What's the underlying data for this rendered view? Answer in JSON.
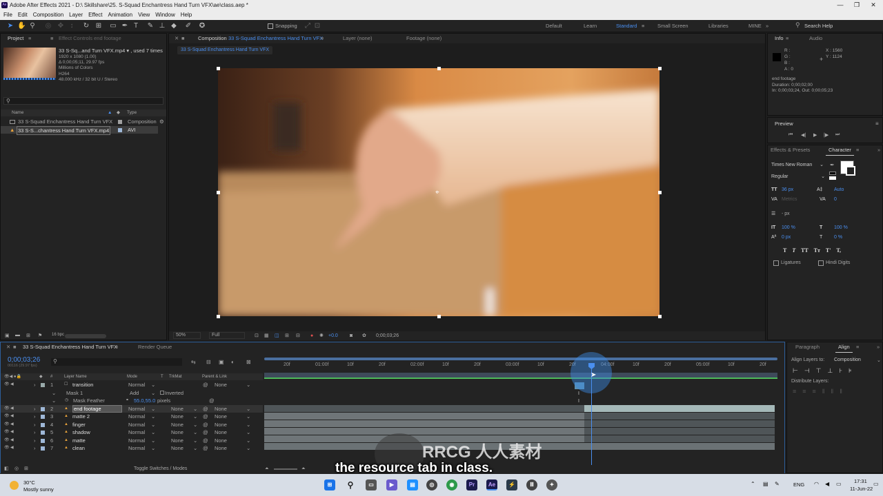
{
  "window": {
    "title": "Adobe After Effects 2021 - D:\\ Skillshare\\25. S-Squad Enchantress Hand Turn VFX\\ae\\class.aep *",
    "controls": [
      "—",
      "❐",
      "✕"
    ]
  },
  "menu": [
    "File",
    "Edit",
    "Composition",
    "Layer",
    "Effect",
    "Animation",
    "View",
    "Window",
    "Help"
  ],
  "toolbar": {
    "snapping_label": "Snapping",
    "workspaces": [
      "Default",
      "Learn",
      "Standard",
      "Small Screen",
      "Libraries",
      "MINE"
    ],
    "active_workspace": "Standard",
    "search_placeholder": "Search Help"
  },
  "project_panel": {
    "tab_project": "Project",
    "tab_effect_controls": "Effect Controls end footage",
    "item_title": "33 S-Sq...and Turn VFX.mp4 ▾ , used 7 times",
    "item_meta": [
      "1920 x 1080 (1.00)",
      "Δ 0;00;05;11, 29.97 fps",
      "Millions of Colors",
      "H264",
      "48.000 kHz / 32 bit U / Stereo"
    ],
    "search_placeholder": "",
    "columns": {
      "name": "Name",
      "type": "Type"
    },
    "items": [
      {
        "name": "33 S-Squad Enchantress Hand Turn VFX",
        "type": "Composition"
      },
      {
        "name": "33 S-S...chantress Hand Turn VFX.mp4",
        "type": "AVI"
      }
    ],
    "bpc": "16 bpc"
  },
  "comp_panel": {
    "tab_comp": "Composition",
    "comp_name": "33 S-Squad Enchantress Hand Turn VFX",
    "tab_layer": "Layer (none)",
    "tab_footage": "Footage (none)",
    "sub_tab": "33 S-Squad Enchantress Hand Turn VFX",
    "zoom": "50%",
    "resolution": "Full",
    "exposure": "+0.0",
    "timecode": "0;00;03;26"
  },
  "info_panel": {
    "tab_info": "Info",
    "tab_audio": "Audio",
    "channels": [
      "R :",
      "G :",
      "B :",
      "A : 0"
    ],
    "x": "X : 1560",
    "y": "Y : 1124",
    "layer_info": [
      "end footage",
      "Duration: 0;00;02;00",
      "In: 0;00;03;24, Out: 0;00;05;23"
    ]
  },
  "preview_panel": {
    "title": "Preview",
    "buttons": [
      "⏮",
      "◀|",
      "▶",
      "|▶",
      "⏭"
    ]
  },
  "character_panel": {
    "tab_effects": "Effects & Presets",
    "tab_character": "Character",
    "font": "Times New Roman",
    "style": "Regular",
    "size": "36 px",
    "leading": "Auto",
    "kerning": "Metrics",
    "tracking": "0",
    "stroke_width": "- px",
    "vscale": "100 %",
    "hscale": "100 %",
    "baseline": "0 px",
    "tsume": "0 %",
    "styles": [
      "T",
      "T",
      "TT",
      "Tт",
      "T'",
      "T,"
    ],
    "ligatures": "Ligatures",
    "hindi": "Hindi Digits"
  },
  "paragraph_panel": {
    "tab_paragraph": "Paragraph",
    "tab_align": "Align",
    "align_to_label": "Align Layers to:",
    "align_to_value": "Composition",
    "distribute_label": "Distribute Layers:"
  },
  "timeline": {
    "tab_comp": "33 S-Squad Enchantress Hand Turn VFX",
    "tab_render": "Render Queue",
    "timecode": "0;00;03;26",
    "frame_info": "00116 (29.97 fps)",
    "columns": {
      "num": "#",
      "name": "Layer Name",
      "mode": "Mode",
      "t": "T",
      "trkmat": "TrkMat",
      "parent": "Parent & Link"
    },
    "ruler": [
      "20f",
      "01:00f",
      "10f",
      "20f",
      "02:00f",
      "10f",
      "20f",
      "03:00f",
      "10f",
      "20f",
      "04:00f",
      "10f",
      "20f",
      "05:00f",
      "10f",
      "20f"
    ],
    "layers": [
      {
        "num": "1",
        "name": "transition",
        "mode": "Normal",
        "trkmat": "",
        "parent": "None"
      },
      {
        "num": "",
        "name": "Mask 1",
        "mode": "Add",
        "trkmat": "Inverted",
        "parent": ""
      },
      {
        "num": "",
        "name": "Mask Feather",
        "mode": "55.0,55.0",
        "trkmat": "pixels",
        "parent": ""
      },
      {
        "num": "2",
        "name": "end footage",
        "mode": "Normal",
        "trkmat": "None",
        "parent": "None"
      },
      {
        "num": "3",
        "name": "matte 2",
        "mode": "Normal",
        "trkmat": "None",
        "parent": "None"
      },
      {
        "num": "4",
        "name": "finger",
        "mode": "Normal",
        "trkmat": "None",
        "parent": "None"
      },
      {
        "num": "5",
        "name": "shadow",
        "mode": "Normal",
        "trkmat": "None",
        "parent": "None"
      },
      {
        "num": "6",
        "name": "matte",
        "mode": "Normal",
        "trkmat": "None",
        "parent": "None"
      },
      {
        "num": "7",
        "name": "clean",
        "mode": "Normal",
        "trkmat": "None",
        "parent": "None"
      }
    ],
    "toggle_label": "Toggle Switches / Modes"
  },
  "subtitle": "the resource tab in class.",
  "watermark": "RRCG 人人素材",
  "taskbar": {
    "weather_temp": "30°C",
    "weather_desc": "Mostly sunny",
    "lang": "ENG",
    "time": "17:31",
    "date": "11-Jun-22"
  },
  "colors": {
    "accent": "#4a8ff0",
    "panel": "#232323",
    "label_orange": "#e8a33c"
  }
}
